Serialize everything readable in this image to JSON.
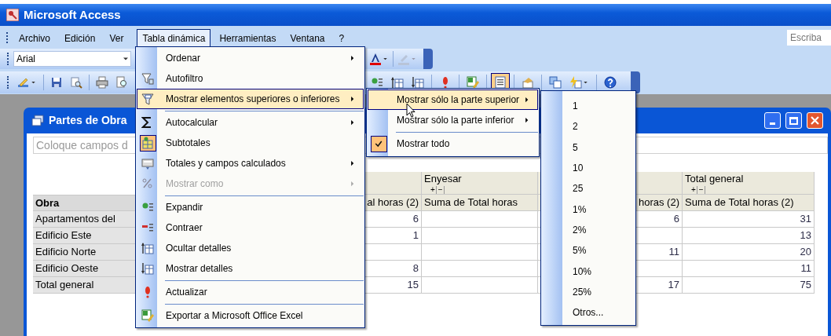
{
  "app_title": "Microsoft Access",
  "menu_bar": {
    "items": [
      {
        "label": "Archivo",
        "selected": false
      },
      {
        "label": "Edición",
        "selected": false
      },
      {
        "label": "Ver",
        "selected": false
      },
      {
        "label": "Tabla dinámica",
        "selected": true
      },
      {
        "label": "Herramientas",
        "selected": false
      },
      {
        "label": "Ventana",
        "selected": false
      },
      {
        "label": "?",
        "selected": false
      }
    ],
    "help_search": {
      "placeholder": "Escriba"
    }
  },
  "formatting_toolbar": {
    "font": "Arial"
  },
  "pivot_toolbar": {
    "buttons": [
      {
        "selected": false
      },
      {
        "selected": false
      },
      {
        "selected": false
      },
      {
        "selected": false
      },
      {
        "selected": false
      },
      {
        "selected": false
      },
      {
        "selected": false
      },
      {
        "selected": false
      },
      {
        "selected": false
      },
      {
        "selected": false
      },
      {
        "selected": true
      },
      {
        "selected": false
      },
      {
        "selected": false
      },
      {
        "selected": false
      },
      {
        "selected": false
      }
    ]
  },
  "pivot_window": {
    "title": "Partes de Obra",
    "filter_hint": "Coloque campos d",
    "column_fields": [
      {
        "label": "Enyesar",
        "expand": "+",
        "collapse": "−"
      },
      {
        "label": "Total general",
        "expand": "+",
        "collapse": "−"
      }
    ],
    "headers": [
      "Obra",
      "al horas (2)",
      "Suma de Total horas",
      "horas (2)",
      "Suma de Total horas (2)"
    ],
    "rows": [
      {
        "label": "Apartamentos del",
        "values": {
          "col_a": "6",
          "col_c": "6",
          "col_d": "31"
        }
      },
      {
        "label": "Edificio Este",
        "values": {
          "col_a": "1",
          "col_d": "13"
        }
      },
      {
        "label": "Edificio Norte",
        "values": {
          "col_c": "11",
          "col_d": "20"
        }
      },
      {
        "label": "Edificio Oeste",
        "values": {
          "col_a": "8",
          "col_d": "11"
        }
      },
      {
        "label": "Total general",
        "values": {
          "col_a": "15",
          "col_c": "17",
          "col_d": "75"
        }
      }
    ]
  },
  "menu": {
    "items": [
      {
        "kind": "item",
        "label": "Ordenar",
        "submenu": true,
        "disabled": false,
        "selected": false,
        "checked": false
      },
      {
        "kind": "item",
        "label": "Autofiltro",
        "submenu": false,
        "disabled": false,
        "selected": false,
        "checked": false
      },
      {
        "kind": "item",
        "label": "Mostrar elementos superiores o inferiores",
        "submenu": true,
        "disabled": false,
        "selected": true,
        "checked": false
      },
      {
        "kind": "separator"
      },
      {
        "kind": "item",
        "label": "Autocalcular",
        "submenu": true,
        "disabled": false,
        "selected": false,
        "checked": false
      },
      {
        "kind": "item",
        "label": "Subtotales",
        "submenu": false,
        "disabled": false,
        "selected": false,
        "checked": true
      },
      {
        "kind": "item",
        "label": "Totales y campos calculados",
        "submenu": true,
        "disabled": false,
        "selected": false,
        "checked": false
      },
      {
        "kind": "item",
        "label": "Mostrar como",
        "submenu": true,
        "disabled": true,
        "selected": false,
        "checked": false
      },
      {
        "kind": "separator"
      },
      {
        "kind": "item",
        "label": "Expandir",
        "submenu": false,
        "disabled": false,
        "selected": false,
        "checked": false
      },
      {
        "kind": "item",
        "label": "Contraer",
        "submenu": false,
        "disabled": false,
        "selected": false,
        "checked": false
      },
      {
        "kind": "item",
        "label": "Ocultar detalles",
        "submenu": false,
        "disabled": false,
        "selected": false,
        "checked": false
      },
      {
        "kind": "item",
        "label": "Mostrar detalles",
        "submenu": false,
        "disabled": false,
        "selected": false,
        "checked": false
      },
      {
        "kind": "separator"
      },
      {
        "kind": "item",
        "label": "Actualizar",
        "submenu": false,
        "disabled": false,
        "selected": false,
        "checked": false
      },
      {
        "kind": "separator"
      },
      {
        "kind": "item",
        "label": "Exportar a Microsoft Office Excel",
        "submenu": false,
        "disabled": false,
        "selected": false,
        "checked": false
      }
    ]
  },
  "submenu": {
    "items": [
      {
        "kind": "item",
        "label": "Mostrar sólo la parte superior",
        "submenu": true,
        "selected": true,
        "checked": false
      },
      {
        "kind": "item",
        "label": "Mostrar sólo la parte inferior",
        "submenu": true,
        "selected": false,
        "checked": false
      },
      {
        "kind": "separator"
      },
      {
        "kind": "item",
        "label": "Mostrar todo",
        "submenu": false,
        "selected": false,
        "checked": true
      }
    ]
  },
  "submenu_2": {
    "items": [
      {
        "label": "1",
        "selected": false
      },
      {
        "label": "2",
        "selected": false
      },
      {
        "label": "5",
        "selected": false
      },
      {
        "label": "10",
        "selected": false
      },
      {
        "label": "25",
        "selected": false
      },
      {
        "label": "1%",
        "selected": false
      },
      {
        "label": "2%",
        "selected": false
      },
      {
        "label": "5%",
        "selected": false
      },
      {
        "label": "10%",
        "selected": false
      },
      {
        "label": "25%",
        "selected": false
      },
      {
        "label": "Otros...",
        "selected": false
      }
    ]
  }
}
